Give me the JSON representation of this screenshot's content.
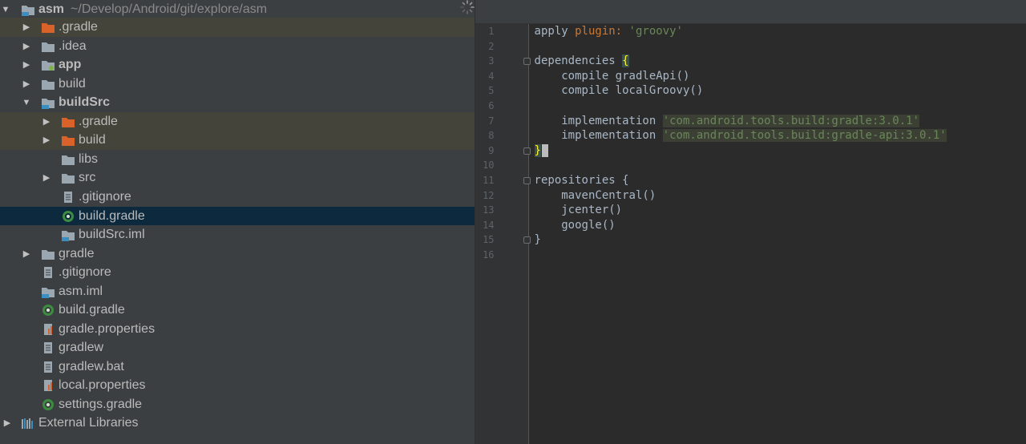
{
  "project_tree": {
    "root": {
      "name": "asm",
      "path": "~/Develop/Android/git/explore/asm"
    },
    "items": [
      {
        "label": ".gradle"
      },
      {
        "label": ".idea"
      },
      {
        "label": "app"
      },
      {
        "label": "build"
      },
      {
        "label": "buildSrc"
      },
      {
        "label": ".gradle"
      },
      {
        "label": "build"
      },
      {
        "label": "libs"
      },
      {
        "label": "src"
      },
      {
        "label": ".gitignore"
      },
      {
        "label": "build.gradle"
      },
      {
        "label": "buildSrc.iml"
      },
      {
        "label": "gradle"
      },
      {
        "label": ".gitignore"
      },
      {
        "label": "asm.iml"
      },
      {
        "label": "build.gradle"
      },
      {
        "label": "gradle.properties"
      },
      {
        "label": "gradlew"
      },
      {
        "label": "gradlew.bat"
      },
      {
        "label": "local.properties"
      },
      {
        "label": "settings.gradle"
      },
      {
        "label": "External Libraries"
      }
    ]
  },
  "editor": {
    "line_numbers": [
      "1",
      "2",
      "3",
      "4",
      "5",
      "6",
      "7",
      "8",
      "9",
      "10",
      "11",
      "12",
      "13",
      "14",
      "15",
      "16"
    ],
    "code": {
      "l1_a": "apply ",
      "l1_b": "plugin:",
      "l1_c": " 'groovy'",
      "l3_a": "dependencies ",
      "l3_b": "{",
      "l4": "    compile gradleApi()",
      "l5": "    compile localGroovy()",
      "l7_a": "    implementation ",
      "l7_b": "'com.android.tools.build:gradle:3.0.1'",
      "l8_a": "    implementation ",
      "l8_b": "'com.android.tools.build:gradle-api:3.0.1'",
      "l9": "}",
      "l11": "repositories {",
      "l12": "    mavenCentral()",
      "l13": "    jcenter()",
      "l14": "    google()",
      "l15": "}"
    }
  },
  "colors": {
    "tree_bg": "#3c3f41",
    "selection": "#0d293e",
    "editor_bg": "#2b2b2b",
    "keyword": "#cc7832",
    "string": "#6a8759"
  }
}
